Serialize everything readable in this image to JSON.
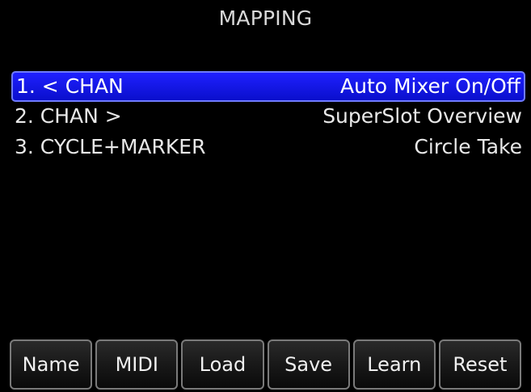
{
  "header": {
    "title": "MAPPING"
  },
  "mappings": [
    {
      "left": "1. < CHAN",
      "right": "Auto Mixer On/Off",
      "selected": true
    },
    {
      "left": "2. CHAN >",
      "right": "SuperSlot Overview",
      "selected": false
    },
    {
      "left": "3. CYCLE+MARKER",
      "right": "Circle Take",
      "selected": false
    }
  ],
  "softkeys": {
    "name": "Name",
    "midi": "MIDI",
    "load": "Load",
    "save": "Save",
    "learn": "Learn",
    "reset": "Reset"
  },
  "colors": {
    "background": "#000000",
    "selected_row": "#1515ee",
    "selected_border": "#6f7bff",
    "text": "#e8e8e8"
  }
}
